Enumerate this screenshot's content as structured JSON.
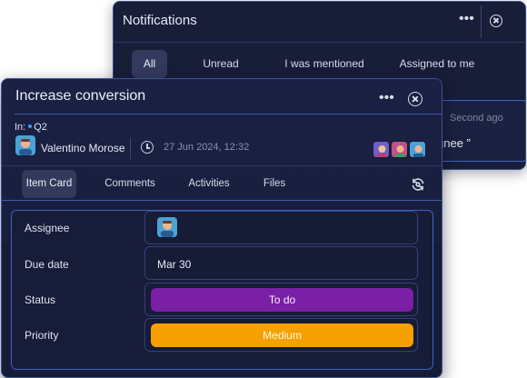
{
  "notifications": {
    "title": "Notifications",
    "more_label": "•••",
    "tabs": [
      {
        "label": "All",
        "active": true
      },
      {
        "label": "Unread",
        "active": false
      },
      {
        "label": "I was mentioned",
        "active": false
      },
      {
        "label": "Assigned to me",
        "active": false
      }
    ],
    "card": {
      "time": "Second ago",
      "message": "gnee ”"
    }
  },
  "item": {
    "title": "Increase conversion",
    "more_label": "•••",
    "in_label": "In:",
    "in_value": "Q2",
    "owner_name": "Valentino Morose",
    "date": "27 Jun 2024, 12:32",
    "tabs": [
      {
        "label": "Item Card",
        "active": true
      },
      {
        "label": "Comments",
        "active": false
      },
      {
        "label": "Activities",
        "active": false
      },
      {
        "label": "Files",
        "active": false
      }
    ],
    "fields": {
      "assignee_label": "Assignee",
      "due_label": "Due date",
      "due_value": "Mar 30",
      "status_label": "Status",
      "status_value": "To do",
      "priority_label": "Priority",
      "priority_value": "Medium"
    }
  },
  "colors": {
    "status": "#7a1fa6",
    "priority": "#f7a100",
    "accent": "#3d63c4"
  },
  "icons": [
    "more-icon",
    "close-icon",
    "clock-icon",
    "sync-icon"
  ]
}
